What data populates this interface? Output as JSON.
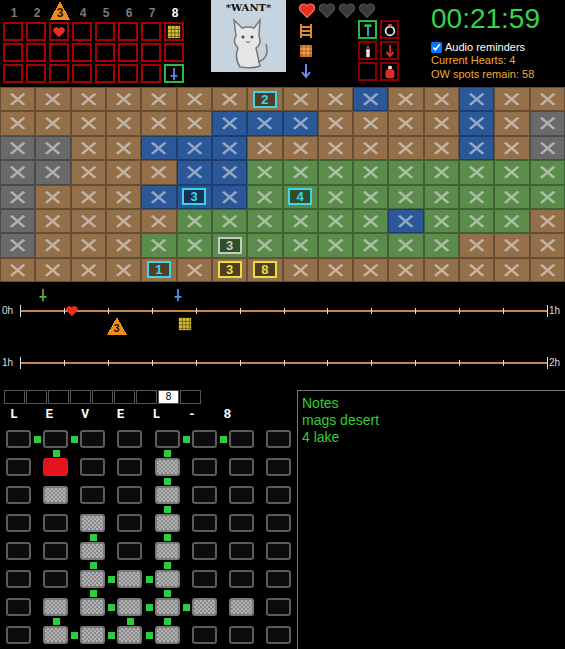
{
  "levels": [
    {
      "label": "1",
      "triforce": false,
      "selected": false,
      "slots": [
        "empty",
        "empty",
        "empty"
      ]
    },
    {
      "label": "2",
      "triforce": false,
      "selected": false,
      "slots": [
        "empty",
        "empty",
        "empty"
      ]
    },
    {
      "label": "3",
      "triforce": true,
      "selected": false,
      "slots": [
        "heart",
        "empty",
        "empty"
      ]
    },
    {
      "label": "4",
      "triforce": false,
      "selected": false,
      "slots": [
        "empty",
        "empty",
        "empty"
      ]
    },
    {
      "label": "5",
      "triforce": false,
      "selected": false,
      "slots": [
        "empty",
        "empty",
        "empty"
      ]
    },
    {
      "label": "6",
      "triforce": false,
      "selected": false,
      "slots": [
        "empty",
        "empty",
        "empty"
      ]
    },
    {
      "label": "7",
      "triforce": false,
      "selected": false,
      "slots": [
        "empty",
        "empty",
        "empty"
      ]
    },
    {
      "label": "8",
      "triforce": false,
      "selected": true,
      "slots": [
        "map",
        "empty",
        "sword"
      ]
    }
  ],
  "want_panel": {
    "label": "*WANT*"
  },
  "hearts": [
    {
      "filled": true
    },
    {
      "filled": false
    },
    {
      "filled": false
    },
    {
      "filled": false
    }
  ],
  "inventory": [
    {
      "kind": "ladder"
    },
    {
      "kind": "raft"
    },
    {
      "kind": "arrow"
    }
  ],
  "item_boxes": [
    {
      "kind": "wand",
      "highlight": true
    },
    {
      "kind": "ring",
      "highlight": false
    },
    {
      "kind": "candle",
      "highlight": false
    },
    {
      "kind": "red-arrow",
      "highlight": false
    },
    {
      "kind": "empty",
      "highlight": false
    },
    {
      "kind": "potion",
      "highlight": false
    }
  ],
  "status": {
    "timer": "00:21:59",
    "audio": {
      "label": "Audio reminders",
      "checked": true
    },
    "stats": [
      "Current Hearts: 4",
      "OW spots remain: 58"
    ]
  },
  "overworld": {
    "rows": [
      "BBBBBBBbBBWBBWBB",
      "BBBBBBWWWBBBBWBS",
      "SSBBWWWBBBBBBWBS",
      "SSBBBWWGGGGGGGGG",
      "SBBBWwWGgGGGGGGG",
      "SBBBBGGGGGGWGGGB",
      "SBBBGGgGGGGGGBBB",
      "BBBBbBbbBBBBBBBB"
    ],
    "labels": [
      {
        "text": "2",
        "row": 0,
        "col": 7,
        "color": "#3ad6e8"
      },
      {
        "text": "3",
        "row": 4,
        "col": 5,
        "color": "#3ad6e8"
      },
      {
        "text": "4",
        "row": 4,
        "col": 8,
        "color": "#3ad6e8"
      },
      {
        "text": "3",
        "row": 6,
        "col": 6,
        "color": "#c8c8c8"
      },
      {
        "text": "1",
        "row": 7,
        "col": 4,
        "color": "#3ad6e8"
      },
      {
        "text": "3",
        "row": 7,
        "col": 6,
        "color": "#e8e03a"
      },
      {
        "text": "8",
        "row": 7,
        "col": 7,
        "color": "#e8e03a"
      }
    ]
  },
  "timeline": {
    "span_minutes": 60,
    "tick_minutes": 5,
    "tracks": [
      {
        "start": "0h",
        "end": "1h",
        "events": [
          {
            "kind": "green-sword",
            "label": "",
            "minutes": 2.6
          },
          {
            "kind": "heart",
            "label": "",
            "minutes": 5.9
          },
          {
            "kind": "triforce",
            "label": "3",
            "minutes": 11
          },
          {
            "kind": "blue-sword",
            "label": "",
            "minutes": 18
          },
          {
            "kind": "map",
            "label": "",
            "minutes": 18.8
          }
        ]
      },
      {
        "start": "1h",
        "end": "2h",
        "events": []
      }
    ]
  },
  "dungeon": {
    "tabs": [
      {
        "label": "",
        "selected": false
      },
      {
        "label": "",
        "selected": false
      },
      {
        "label": "",
        "selected": false
      },
      {
        "label": "",
        "selected": false
      },
      {
        "label": "",
        "selected": false
      },
      {
        "label": "",
        "selected": false
      },
      {
        "label": "",
        "selected": false
      },
      {
        "label": "8",
        "selected": true
      },
      {
        "label": "",
        "selected": false
      }
    ],
    "title": "L E V E L - 8",
    "rooms": [
      "........",
      ".R..#...",
      ".#..#...",
      "..#.#...",
      "..#.#...",
      "..###...",
      ".######.",
      ".####..."
    ],
    "h_doors": [
      "1100110",
      "0000000",
      "0000000",
      "0000000",
      "0000000",
      "0011000",
      "0011100",
      "0111000"
    ],
    "v_doors": [
      "01001000",
      "00001000",
      "00001000",
      "00101000",
      "00101000",
      "00101000",
      "01011000"
    ]
  },
  "notes": {
    "title": "Notes",
    "lines": [
      "mags desert",
      "4 lake"
    ]
  }
}
